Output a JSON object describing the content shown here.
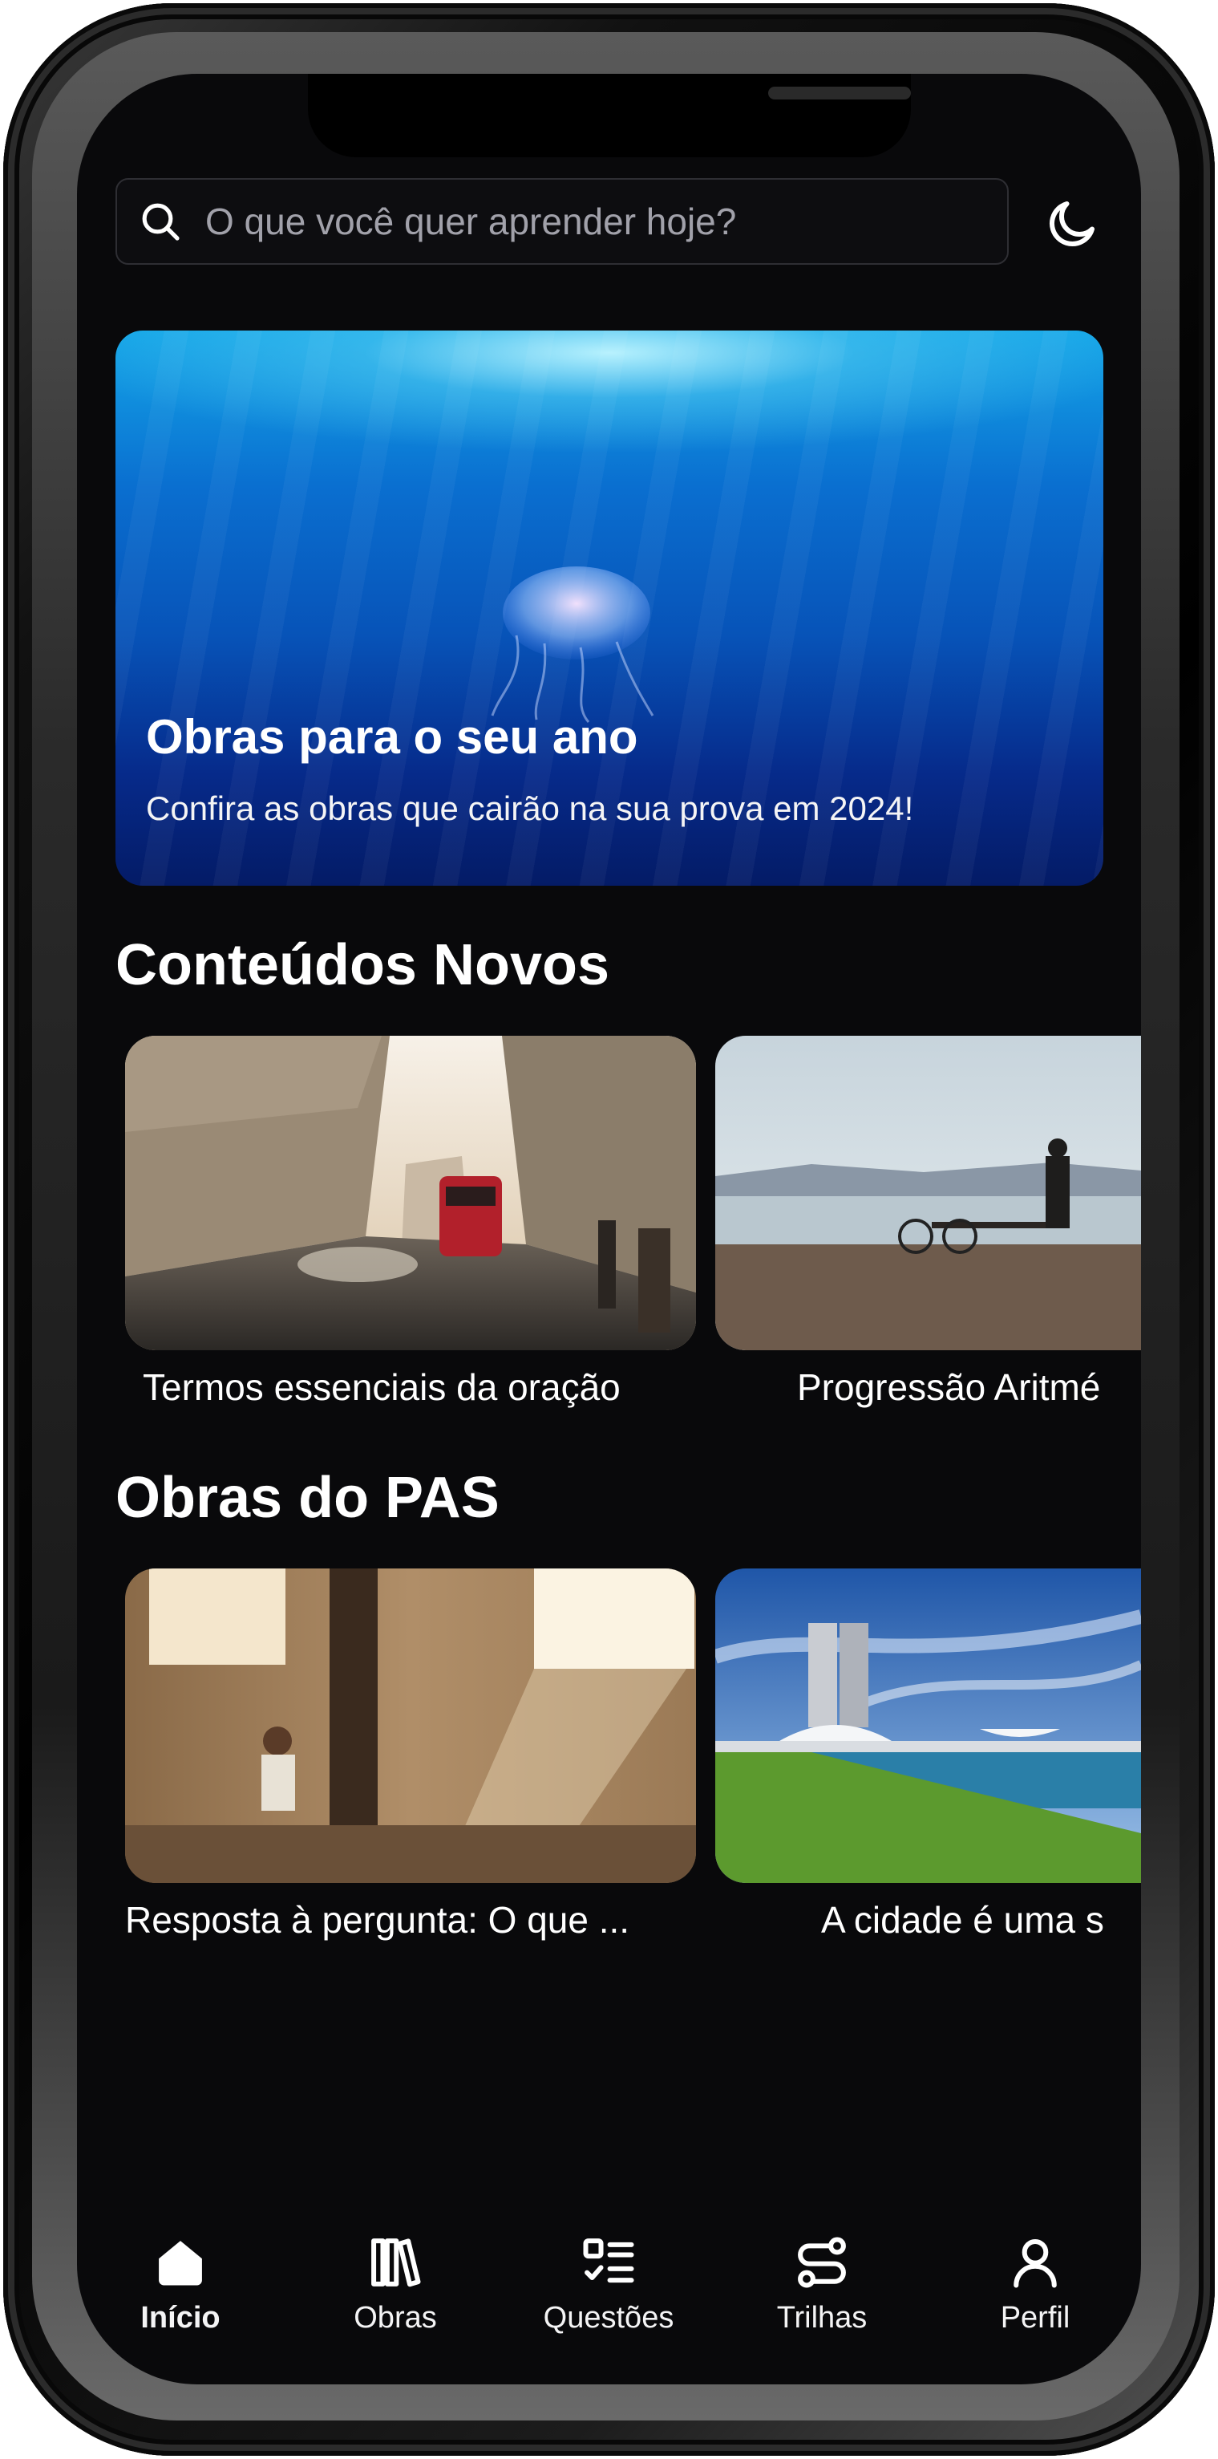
{
  "search": {
    "placeholder": "O que você quer aprender hoje?",
    "icon": "search-icon"
  },
  "theme_toggle": {
    "icon": "moon-icon"
  },
  "banner": {
    "title": "Obras para o seu ano",
    "subtitle": "Confira as obras que cairão na sua prova em 2024!"
  },
  "sections": {
    "new_content": {
      "title": "Conteúdos Novos",
      "items": [
        {
          "label": "Termos essenciais da oração"
        },
        {
          "label": "Progressão Aritmé"
        }
      ]
    },
    "pas_works": {
      "title": "Obras do PAS",
      "items": [
        {
          "label": "Resposta à pergunta: O que ..."
        },
        {
          "label": "A cidade é uma s"
        }
      ]
    }
  },
  "nav": {
    "items": [
      {
        "label": "Início",
        "icon": "home-icon",
        "active": true
      },
      {
        "label": "Obras",
        "icon": "books-icon"
      },
      {
        "label": "Questões",
        "icon": "checklist-icon"
      },
      {
        "label": "Trilhas",
        "icon": "route-icon"
      },
      {
        "label": "Perfil",
        "icon": "user-icon"
      }
    ]
  },
  "colors": {
    "background": "#09090b",
    "text": "#ffffff",
    "muted": "#a1a1aa",
    "accent_blue": "#0753b8"
  }
}
